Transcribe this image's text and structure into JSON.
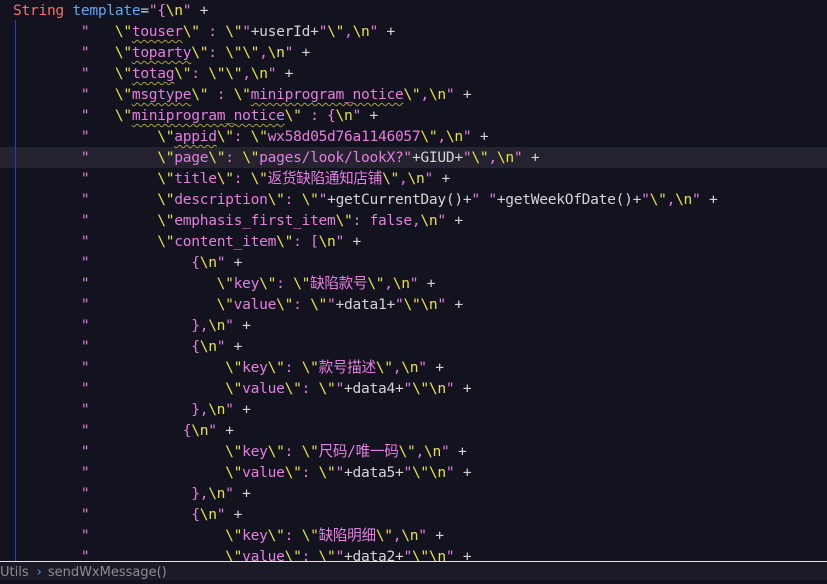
{
  "editor": {
    "highlighted_line": 7,
    "lines": [
      "String template=\"{\\n\" +",
      "        \"   \\\"touser\\\" : \\\"\"+userId+\"\\\",\\n\" +",
      "        \"   \\\"toparty\\\": \\\"\\\",\\n\" +",
      "        \"   \\\"totag\\\": \\\"\\\",\\n\" +",
      "        \"   \\\"msgtype\\\" : \\\"miniprogram_notice\\\",\\n\" +",
      "        \"   \\\"miniprogram_notice\\\" : {\\n\" +",
      "        \"        \\\"appid\\\": \\\"wx58d05d76a1146057\\\",\\n\" +",
      "        \"        \\\"page\\\": \\\"pages/look/lookX?\"+GIUD+\"\\\",\\n\" +",
      "        \"        \\\"title\\\": \\\"返货缺陷通知店铺\\\",\\n\" +",
      "        \"        \\\"description\\\": \\\"\"+getCurrentDay()+\" \"+getWeekOfDate()+\"\\\",\\n\" +",
      "        \"        \\\"emphasis_first_item\\\": false,\\n\" +",
      "        \"        \\\"content_item\\\": [\\n\" +",
      "        \"            {\\n\" +",
      "        \"               \\\"key\\\": \\\"缺陷款号\\\",\\n\" +",
      "        \"               \\\"value\\\": \\\"\"+data1+\"\\\"\\n\" +",
      "        \"            },\\n\" +",
      "        \"            {\\n\" +",
      "        \"                \\\"key\\\": \\\"款号描述\\\",\\n\" +",
      "        \"                \\\"value\\\": \\\"\"+data4+\"\\\"\\n\" +",
      "        \"            },\\n\" +",
      "        \"           {\\n\" +",
      "        \"                \\\"key\\\": \\\"尺码/唯一码\\\",\\n\" +",
      "        \"                \\\"value\\\": \\\"\"+data5+\"\\\"\\n\" +",
      "        \"            },\\n\" +",
      "        \"            {\\n\" +",
      "        \"                \\\"key\\\": \\\"缺陷明细\\\",\\n\" +",
      "        \"                \\\"value\\\": \\\"\"+data2+\"\\\"\\n\" +"
    ]
  },
  "breadcrumb": {
    "class_name": "Utils",
    "method_name": "sendWxMessage()"
  }
}
